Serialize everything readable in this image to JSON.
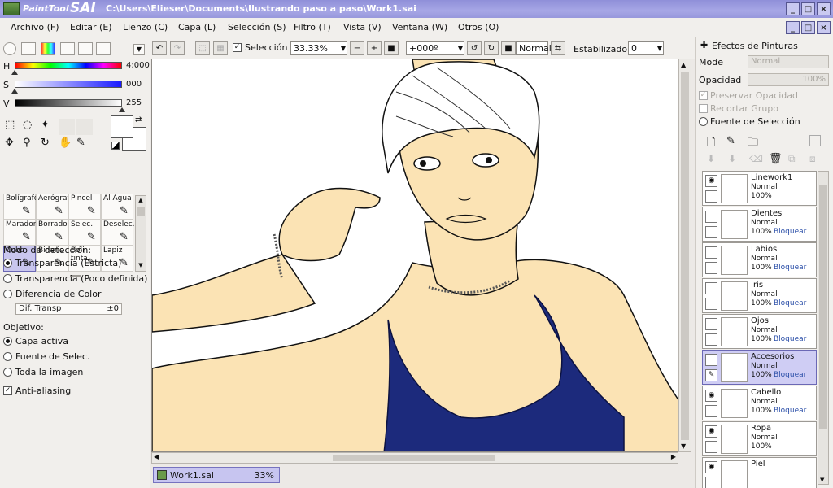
{
  "app": {
    "logo_text_1": "PaintTool",
    "logo_text_2": "SAI",
    "title_path": "C:\\Users\\Elieser\\Documents\\Ilustrando paso a paso\\Work1.sai"
  },
  "menu": [
    {
      "label": "Archivo (F)"
    },
    {
      "label": "Editar (E)"
    },
    {
      "label": "Lienzo (C)"
    },
    {
      "label": "Capa (L)"
    },
    {
      "label": "Selección (S)"
    },
    {
      "label": "Filtro (T)"
    },
    {
      "label": "Vista (V)"
    },
    {
      "label": "Ventana (W)"
    },
    {
      "label": "Otros (O)"
    }
  ],
  "color": {
    "h_label": "H",
    "s_label": "S",
    "v_label": "V",
    "h_value": "4:000",
    "s_value": "000",
    "v_value": "255",
    "h_fraction": 0.0,
    "s_fraction": 0.0,
    "v_fraction": 1.0
  },
  "tools": [
    {
      "label": "Bolígrafo",
      "icon": "pen-icon"
    },
    {
      "label": "Aerógraf",
      "icon": "airbrush-icon"
    },
    {
      "label": "Pincel",
      "icon": "brush-icon"
    },
    {
      "label": "Al Agua",
      "icon": "water-brush-icon"
    },
    {
      "label": "Marador",
      "icon": "marker-icon"
    },
    {
      "label": "Borrador",
      "icon": "eraser-icon"
    },
    {
      "label": "Selec.",
      "icon": "select-brush-icon"
    },
    {
      "label": "Deselec.",
      "icon": "deselect-brush-icon"
    },
    {
      "label": "Cubo",
      "icon": "bucket-icon",
      "selected": true
    },
    {
      "label": "Binario",
      "icon": "binary-pen-icon"
    },
    {
      "label": "Boli tinta",
      "icon": "ink-pen-icon"
    },
    {
      "label": "Lapiz",
      "icon": "pencil-icon"
    }
  ],
  "detection": {
    "heading": "Modo de detección:",
    "options": [
      {
        "label": "Transparencia (Estricta)",
        "selected": true
      },
      {
        "label": "Transparencia (Poco definida)",
        "selected": false
      },
      {
        "label": "Diferencia de Color",
        "selected": false
      }
    ],
    "field_label": "Dif. Transp",
    "field_value": "±0"
  },
  "target": {
    "heading": "Objetivo:",
    "options": [
      {
        "label": "Capa activa",
        "selected": true
      },
      {
        "label": "Fuente de Selec.",
        "selected": false
      },
      {
        "label": "Toda la imagen",
        "selected": false
      }
    ],
    "antialias_label": "Anti-aliasing",
    "antialias_checked": true
  },
  "toolbar": {
    "selection_label": "Selección",
    "selection_checked": true,
    "zoom": "33.33%",
    "rotation": "+000º",
    "blend_mode": "Normal",
    "stabilizer_label": "Estabilizador",
    "stabilizer_value": "0"
  },
  "document": {
    "tab_name": "Work1.sai",
    "tab_zoom": "33%"
  },
  "right": {
    "effects_heading": "Efectos de Pinturas",
    "mode_label": "Mode",
    "mode_value": "Normal",
    "opacity_label": "Opacidad",
    "opacity_value": "100%",
    "preserve_opacity": "Preservar Opacidad",
    "clip_group": "Recortar Grupo",
    "selection_source": "Fuente de Selección"
  },
  "layers": [
    {
      "name": "Linework1",
      "mode": "Normal",
      "opacity": "100%",
      "lock": "",
      "visible": true,
      "is_lineart": true
    },
    {
      "name": "Dientes",
      "mode": "Normal",
      "opacity": "100%",
      "lock": "Bloquear",
      "visible": false
    },
    {
      "name": "Labios",
      "mode": "Normal",
      "opacity": "100%",
      "lock": "Bloquear",
      "visible": false
    },
    {
      "name": "Iris",
      "mode": "Normal",
      "opacity": "100%",
      "lock": "Bloquear",
      "visible": false
    },
    {
      "name": "Ojos",
      "mode": "Normal",
      "opacity": "100%",
      "lock": "Bloquear",
      "visible": false
    },
    {
      "name": "Accesorios",
      "mode": "Normal",
      "opacity": "100%",
      "lock": "Bloquear",
      "visible": false,
      "selected": true
    },
    {
      "name": "Cabello",
      "mode": "Normal",
      "opacity": "100%",
      "lock": "Bloquear",
      "visible": true
    },
    {
      "name": "Ropa",
      "mode": "Normal",
      "opacity": "100%",
      "lock": "",
      "visible": true
    },
    {
      "name": "Piel",
      "mode": "",
      "opacity": "",
      "lock": "",
      "visible": true
    }
  ],
  "colors": {
    "skin": "#fbe3b4",
    "top": "#1c2a7c",
    "accent": "#a7a7e6"
  }
}
